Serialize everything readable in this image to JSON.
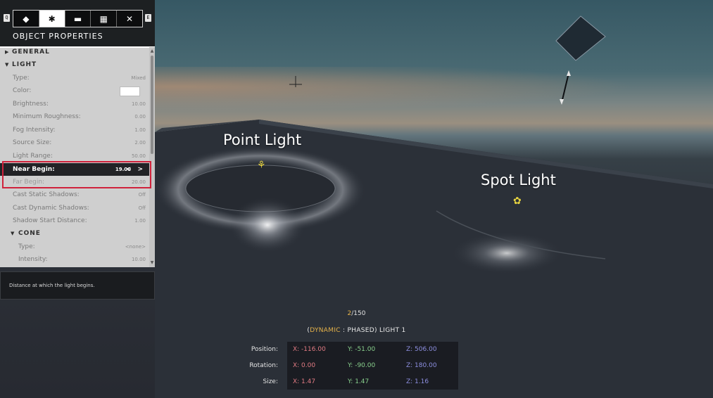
{
  "scene": {
    "labels": {
      "point_light": "Point Light",
      "spot_light": "Spot Light"
    },
    "gizmo_icon": "light-gizmo-icon"
  },
  "panel": {
    "hotkey_left": "Q",
    "hotkey_right": "E",
    "tabs": [
      {
        "icon": "object-browser-icon",
        "glyph": "◆"
      },
      {
        "icon": "gear-icon",
        "glyph": "✱",
        "active": true
      },
      {
        "icon": "folder-icon",
        "glyph": "▬"
      },
      {
        "icon": "map-icon",
        "glyph": "▦"
      },
      {
        "icon": "tools-icon",
        "glyph": "✕"
      }
    ],
    "title": "OBJECT PROPERTIES",
    "sections": {
      "general": "GENERAL",
      "light": "LIGHT",
      "cone": "CONE"
    },
    "rows": {
      "type": {
        "label": "Type:",
        "value": "Mixed"
      },
      "color": {
        "label": "Color:"
      },
      "brightness": {
        "label": "Brightness:",
        "value": "10.00"
      },
      "min_roughness": {
        "label": "Minimum Roughness:",
        "value": "0.00"
      },
      "fog_intensity": {
        "label": "Fog Intensity:",
        "value": "1.00"
      },
      "source_size": {
        "label": "Source Size:",
        "value": "2.00"
      },
      "light_range": {
        "label": "Light Range:",
        "value": "50.00"
      },
      "near_begin": {
        "label": "Near Begin:",
        "value": "19.00"
      },
      "far_begin": {
        "label": "Far Begin:",
        "value": "20.00"
      },
      "cast_static": {
        "label": "Cast Static Shadows:",
        "value": "Off"
      },
      "cast_dynamic": {
        "label": "Cast Dynamic Shadows:",
        "value": "Off"
      },
      "shadow_start": {
        "label": "Shadow Start Distance:",
        "value": "1.00"
      },
      "cone_type": {
        "label": "Type:",
        "value": "<none>"
      },
      "cone_intensity": {
        "label": "Intensity:",
        "value": "10.00"
      }
    },
    "stepper_arrows": "< >",
    "description": "Distance at which the light begins.",
    "colors": {
      "color_swatch": "#ffffff",
      "highlight": "#d0223b"
    }
  },
  "hud": {
    "counter": {
      "current": "2",
      "total": "/150"
    },
    "object": {
      "open": "(",
      "dynamic": "DYNAMIC",
      "rest": " : PHASED) LIGHT 1"
    },
    "position": {
      "label": "Position:",
      "x": "X: -116.00",
      "y": "Y: -51.00",
      "z": "Z: 506.00"
    },
    "rotation": {
      "label": "Rotation:",
      "x": "X: 0.00",
      "y": "Y: -90.00",
      "z": "Z: 180.00"
    },
    "size": {
      "label": "Size:",
      "x": "X: 1.47",
      "y": "Y: 1.47",
      "z": "Z: 1.16"
    }
  }
}
